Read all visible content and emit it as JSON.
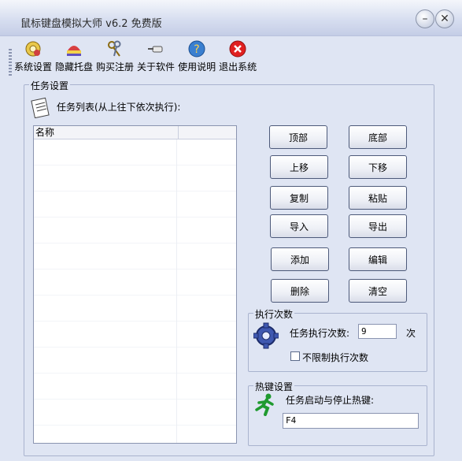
{
  "window": {
    "title": "鼠标键盘模拟大师 v6.2 免费版"
  },
  "toolbar": [
    {
      "label": "系统设置",
      "icon": "settings-icon"
    },
    {
      "label": "隐藏托盘",
      "icon": "tray-icon"
    },
    {
      "label": "购买注册",
      "icon": "keys-icon"
    },
    {
      "label": "关于软件",
      "icon": "pointer-hand-icon"
    },
    {
      "label": "使用说明",
      "icon": "help-icon"
    },
    {
      "label": "退出系统",
      "icon": "exit-icon"
    }
  ],
  "task_group": {
    "title": "任务设置",
    "caption": "任务列表(从上往下依次执行):",
    "list_header": "名称"
  },
  "buttons": {
    "top": "顶部",
    "bottom": "底部",
    "up": "上移",
    "down": "下移",
    "copy": "复制",
    "paste": "粘贴",
    "import": "导入",
    "export": "导出",
    "add": "添加",
    "edit": "编辑",
    "delete": "删除",
    "clear": "清空"
  },
  "exec_group": {
    "title": "执行次数",
    "label": "任务执行次数:",
    "value": "9",
    "unit": "次",
    "unlimited_label": "不限制执行次数",
    "unlimited_checked": false
  },
  "hotkey_group": {
    "title": "热键设置",
    "label": "任务启动与停止热键:",
    "value": "F4"
  }
}
